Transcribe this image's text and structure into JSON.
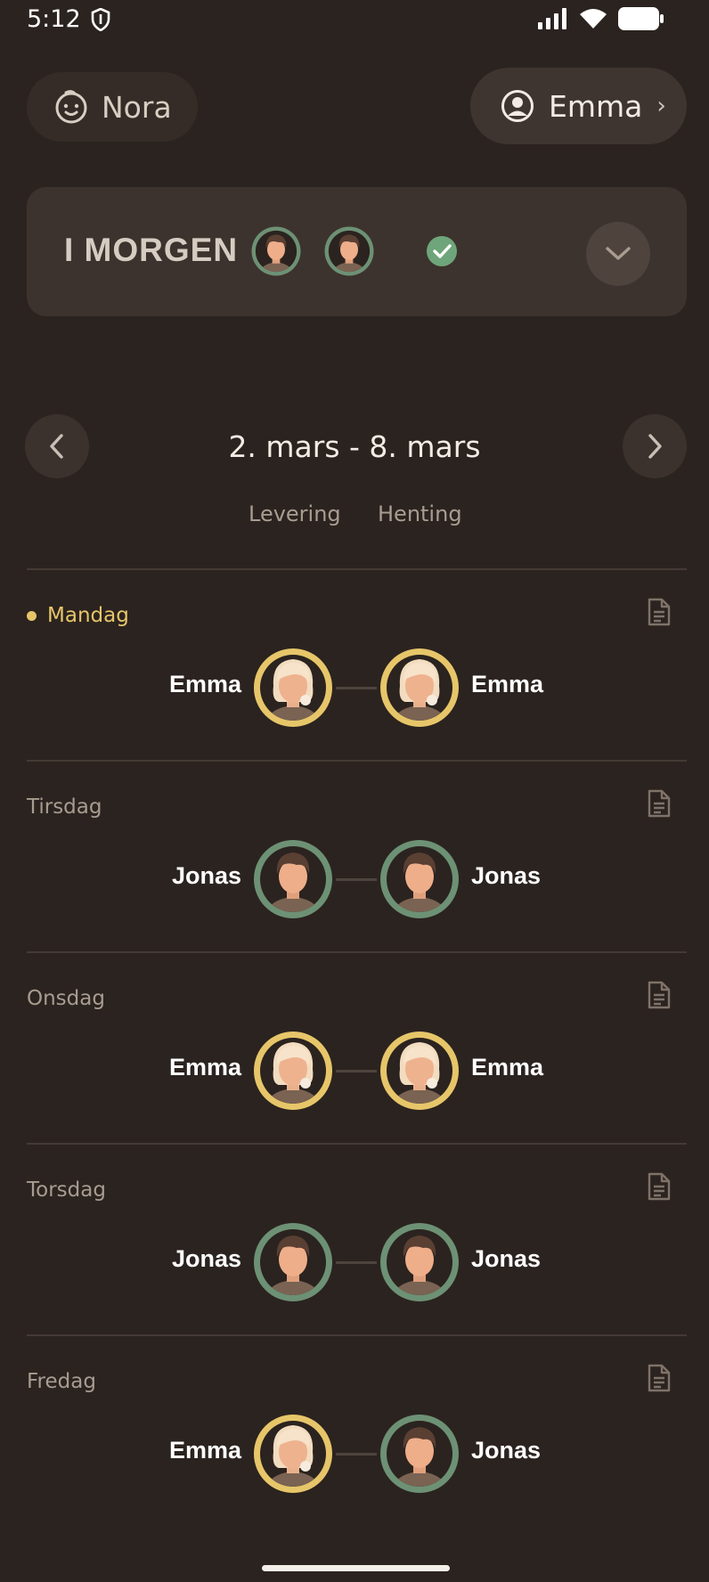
{
  "status_bar": {
    "time": "5:12"
  },
  "header": {
    "child_name": "Nora",
    "user_name": "Emma",
    "user_chevron": "›"
  },
  "tomorrow": {
    "title": "I MORGEN",
    "drop_off": "Jonas",
    "pick_up": "Jonas",
    "confirmed": true
  },
  "week": {
    "range": "2. mars - 8. mars",
    "column_dropoff": "Levering",
    "column_pickup": "Henting"
  },
  "days": [
    {
      "name": "Mandag",
      "today": true,
      "drop_off": "Emma",
      "pick_up": "Emma"
    },
    {
      "name": "Tirsdag",
      "today": false,
      "drop_off": "Jonas",
      "pick_up": "Jonas"
    },
    {
      "name": "Onsdag",
      "today": false,
      "drop_off": "Emma",
      "pick_up": "Emma"
    },
    {
      "name": "Torsdag",
      "today": false,
      "drop_off": "Jonas",
      "pick_up": "Jonas"
    },
    {
      "name": "Fredag",
      "today": false,
      "drop_off": "Emma",
      "pick_up": "Jonas"
    }
  ],
  "colors": {
    "emma_ring": "#e7c66a",
    "jonas_ring": "#6d9175",
    "background": "#2b231f",
    "today_accent": "#e6c56a"
  },
  "icons": {
    "child": "child-face-icon",
    "user": "user-circle-icon",
    "expand": "chevron-down-icon",
    "prev": "chevron-left-icon",
    "next": "chevron-right-icon",
    "note": "document-icon",
    "confirmed": "check-circle-icon"
  }
}
